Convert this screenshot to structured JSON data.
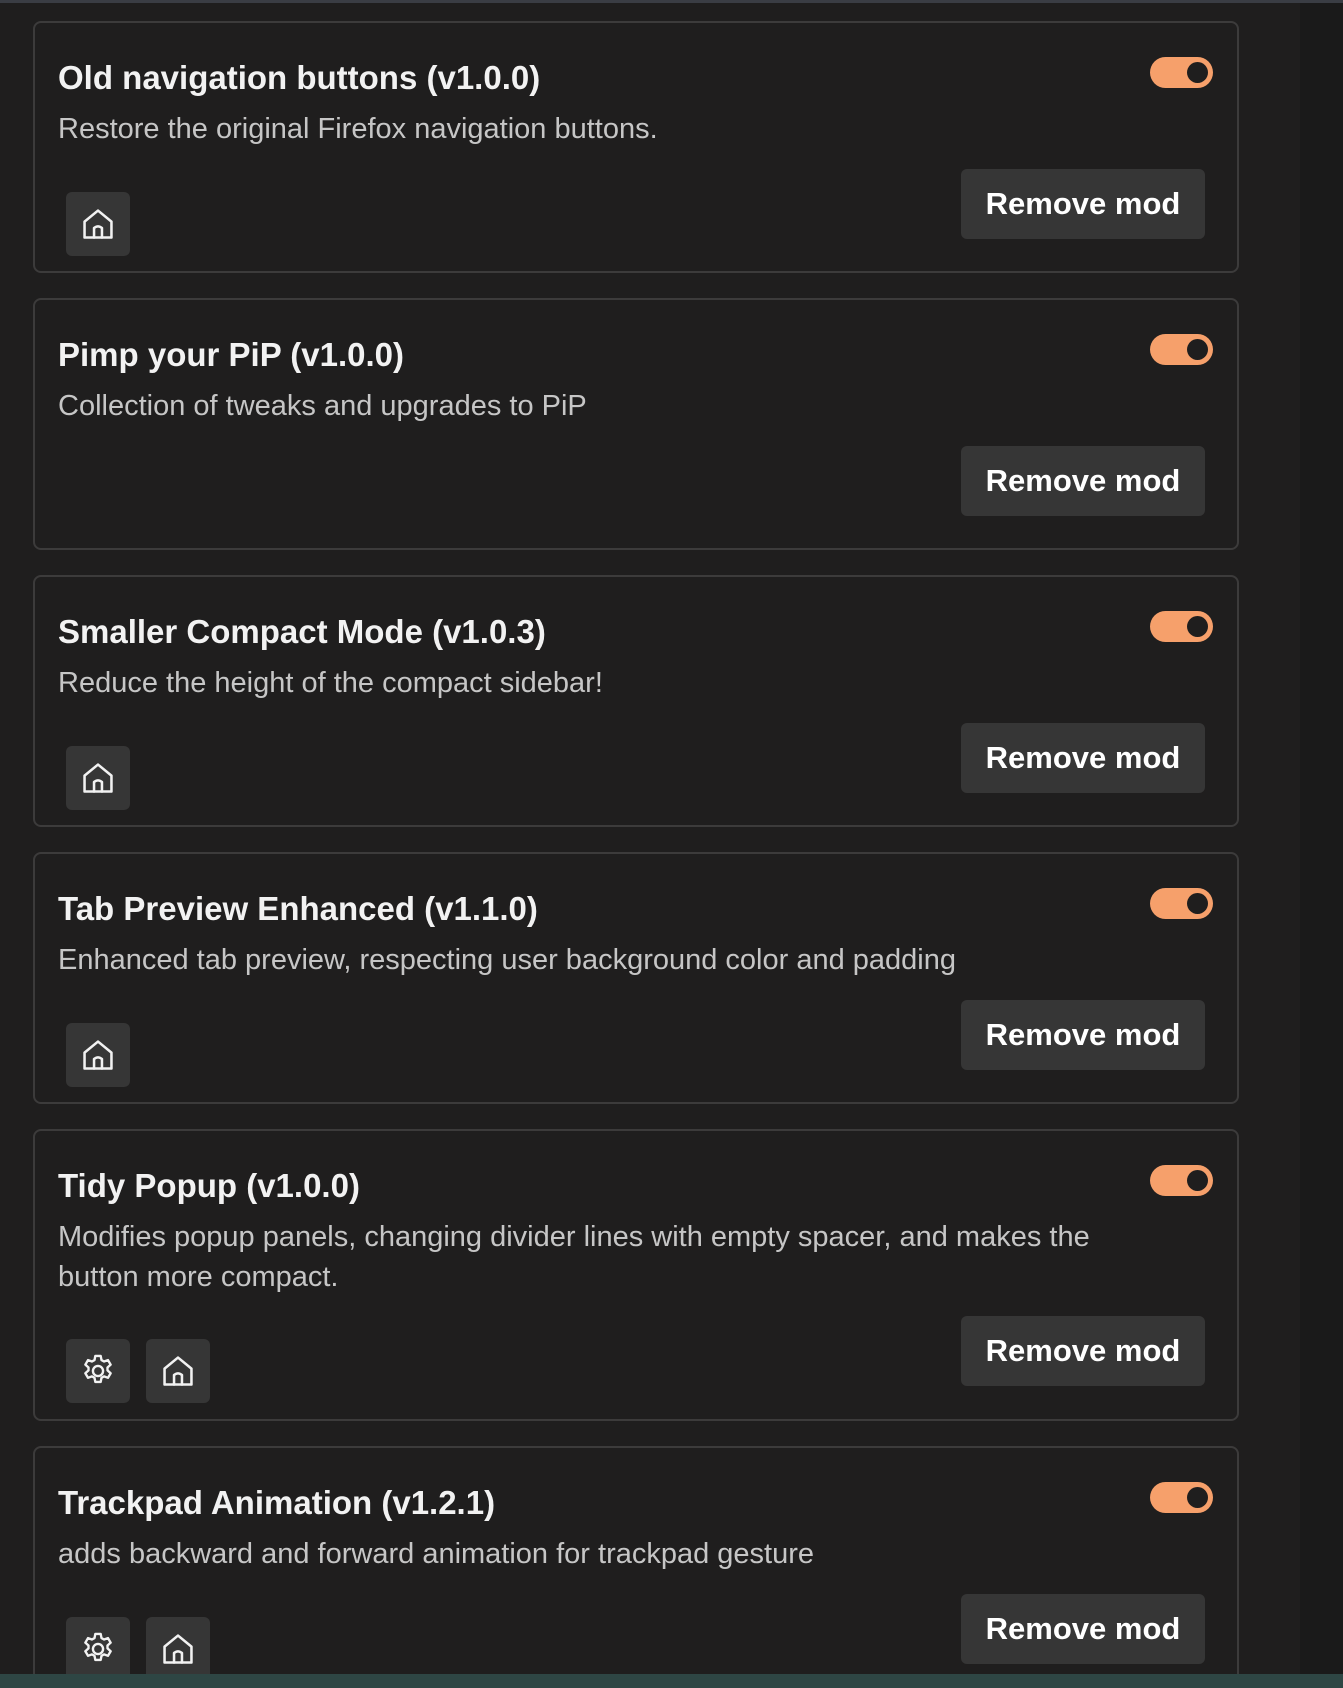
{
  "mods": [
    {
      "title": "Old navigation buttons (v1.0.0)",
      "description": "Restore the original Firefox navigation buttons.",
      "enabled": true,
      "remove_label": "Remove mod",
      "icons": [
        "home-icon"
      ]
    },
    {
      "title": "Pimp your PiP (v1.0.0)",
      "description": "Collection of tweaks and upgrades to PiP",
      "enabled": true,
      "remove_label": "Remove mod",
      "icons": []
    },
    {
      "title": "Smaller Compact Mode (v1.0.3)",
      "description": "Reduce the height of the compact sidebar!",
      "enabled": true,
      "remove_label": "Remove mod",
      "icons": [
        "home-icon"
      ]
    },
    {
      "title": "Tab Preview Enhanced (v1.1.0)",
      "description": "Enhanced tab preview, respecting user background color and padding",
      "enabled": true,
      "remove_label": "Remove mod",
      "icons": [
        "home-icon"
      ]
    },
    {
      "title": "Tidy Popup (v1.0.0)",
      "description": "Modifies popup panels, changing divider lines with empty spacer, and makes the button more compact.",
      "enabled": true,
      "remove_label": "Remove mod",
      "icons": [
        "gear-icon",
        "home-icon"
      ]
    },
    {
      "title": "Trackpad Animation (v1.2.1)",
      "description": "adds backward and forward animation for trackpad gesture",
      "enabled": true,
      "remove_label": "Remove mod",
      "icons": [
        "gear-icon",
        "home-icon"
      ]
    }
  ],
  "colors": {
    "toggle_on": "#f6a06b",
    "card_border": "#3c3b3b",
    "background": "#1f1e1e",
    "button_bg": "#363636"
  }
}
